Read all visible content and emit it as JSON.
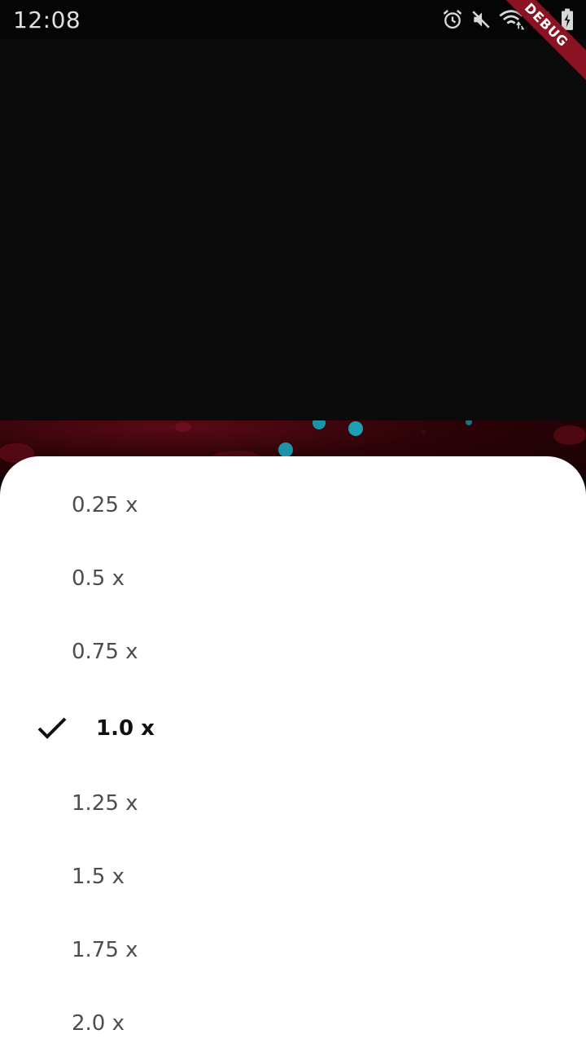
{
  "status_bar": {
    "time": "12:08",
    "icons": [
      "alarm-icon",
      "mute-icon",
      "wifi-icon",
      "signal-icon",
      "battery-charging-icon"
    ]
  },
  "debug_banner": {
    "label": "DEBUG",
    "color": "#8a1323"
  },
  "playback_speed_sheet": {
    "options": [
      {
        "label": "0.25 x",
        "selected": false
      },
      {
        "label": "0.5 x",
        "selected": false
      },
      {
        "label": "0.75 x",
        "selected": false
      },
      {
        "label": "1.0 x",
        "selected": true
      },
      {
        "label": "1.25 x",
        "selected": false
      },
      {
        "label": "1.5 x",
        "selected": false
      },
      {
        "label": "1.75 x",
        "selected": false
      },
      {
        "label": "2.0 x",
        "selected": false
      }
    ],
    "check_icon": "check-icon"
  }
}
